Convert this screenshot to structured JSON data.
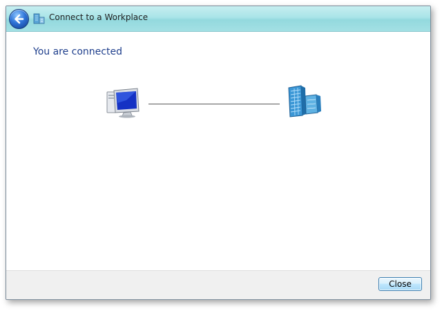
{
  "window": {
    "title": "Connect to a Workplace",
    "title_icon": "workplace-building-icon",
    "back_button_icon": "back-arrow-icon"
  },
  "main": {
    "heading": "You are connected",
    "left_icon": "computer-icon",
    "right_icon": "workplace-building-icon"
  },
  "footer": {
    "close_label": "Close"
  },
  "colors": {
    "titlebar": "#a9e4e8",
    "heading": "#1e3e8c",
    "footer": "#f0f0f0",
    "button_border": "#3c7fb1"
  }
}
